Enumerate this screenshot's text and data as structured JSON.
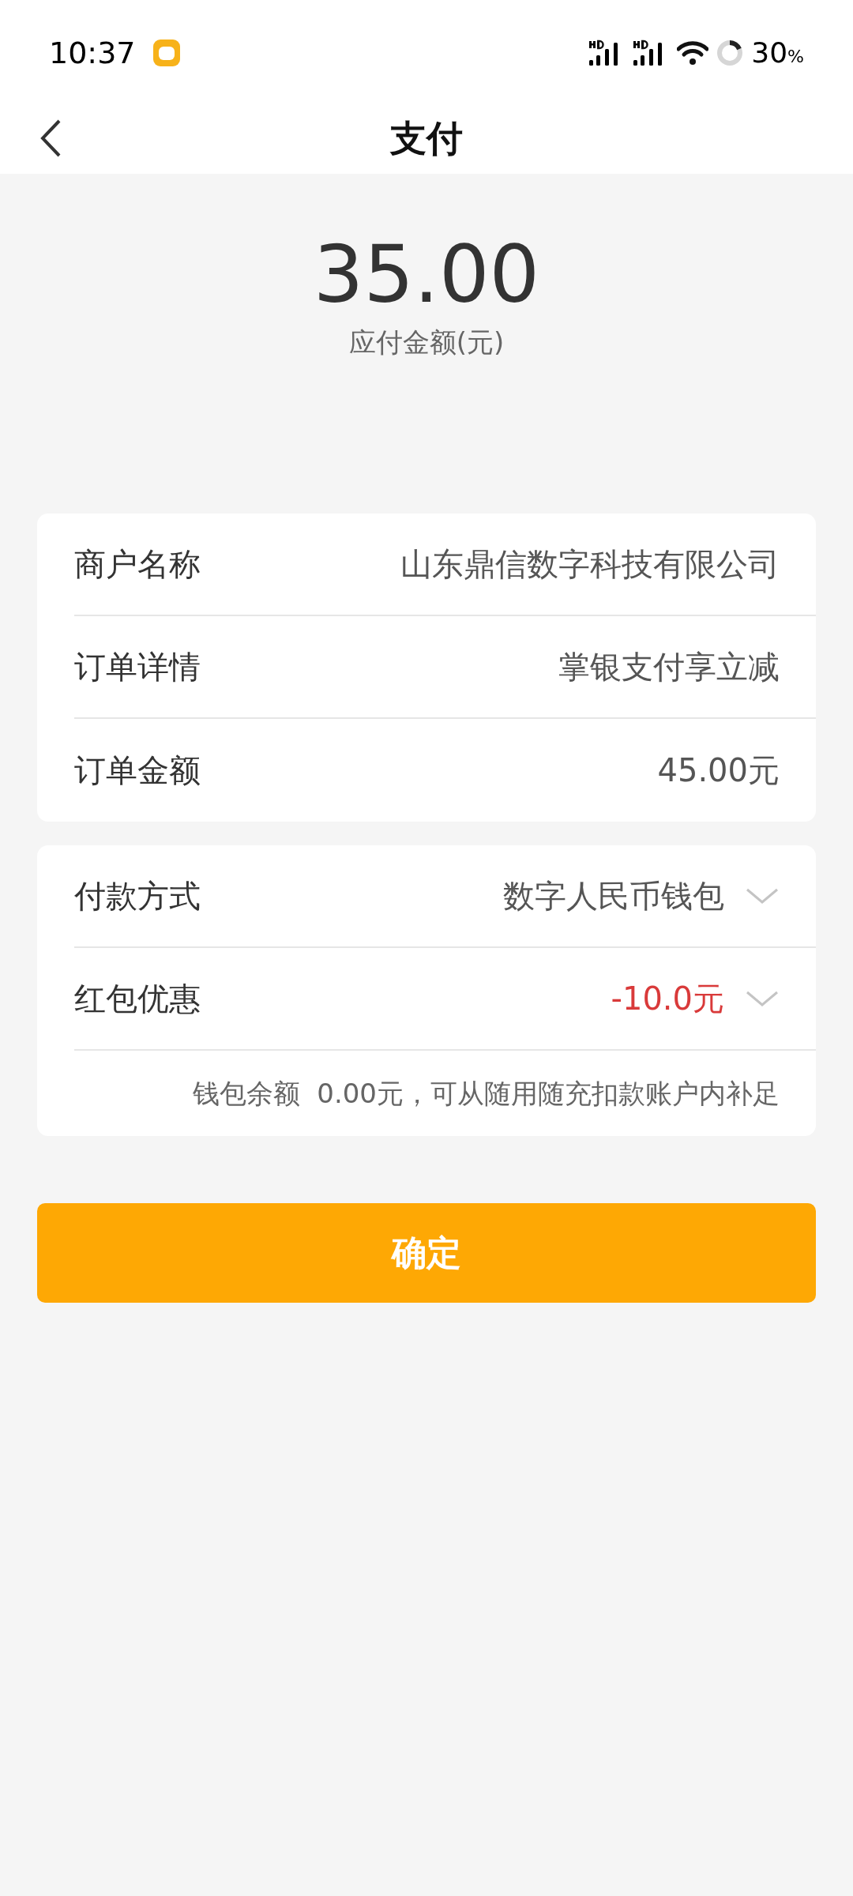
{
  "status_bar": {
    "time": "10:37",
    "battery": "30",
    "battery_unit": "%"
  },
  "header": {
    "title": "支付"
  },
  "amount": {
    "value": "35.00",
    "label": "应付金额(元)"
  },
  "order_card": {
    "rows": [
      {
        "label": "商户名称",
        "value": "山东鼎信数字科技有限公司"
      },
      {
        "label": "订单详情",
        "value": "掌银支付享立减"
      },
      {
        "label": "订单金额",
        "value": "45.00元"
      }
    ]
  },
  "payment_card": {
    "rows": [
      {
        "label": "付款方式",
        "value": "数字人民币钱包",
        "kind": "plain"
      },
      {
        "label": "红包优惠",
        "value": "-10.0元",
        "kind": "discount"
      }
    ],
    "note": "钱包余额  0.00元，可从随用随充扣款账户内补足"
  },
  "confirm_button": "确定"
}
